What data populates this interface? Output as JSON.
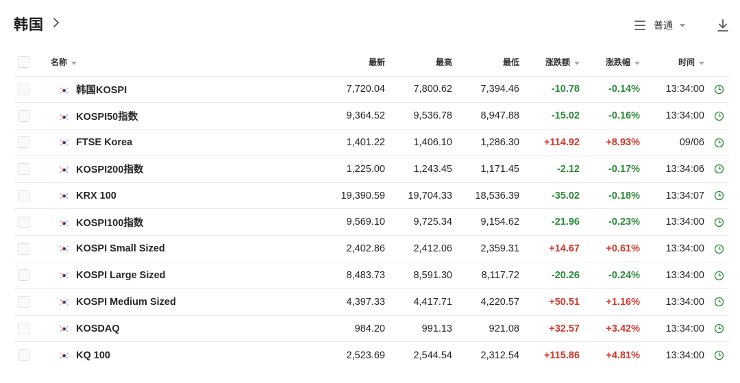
{
  "header": {
    "title": "韩国",
    "view_mode": "普通"
  },
  "table": {
    "columns": {
      "name": "名称",
      "latest": "最新",
      "high": "最高",
      "low": "最低",
      "change": "涨跌额",
      "change_pct": "涨跌幅",
      "time": "时间"
    },
    "rows": [
      {
        "name": "韩国KOSPI",
        "latest": "7,720.04",
        "high": "7,800.62",
        "low": "7,394.46",
        "change": "-10.78",
        "change_pct": "-0.14%",
        "time": "13:34:00",
        "dir": "down"
      },
      {
        "name": "KOSPI50指数",
        "latest": "9,364.52",
        "high": "9,536.78",
        "low": "8,947.88",
        "change": "-15.02",
        "change_pct": "-0.16%",
        "time": "13:34:00",
        "dir": "down"
      },
      {
        "name": "FTSE Korea",
        "latest": "1,401.22",
        "high": "1,406.10",
        "low": "1,286.30",
        "change": "+114.92",
        "change_pct": "+8.93%",
        "time": "09/06",
        "dir": "up"
      },
      {
        "name": "KOSPI200指数",
        "latest": "1,225.00",
        "high": "1,243.45",
        "low": "1,171.45",
        "change": "-2.12",
        "change_pct": "-0.17%",
        "time": "13:34:06",
        "dir": "down"
      },
      {
        "name": "KRX 100",
        "latest": "19,390.59",
        "high": "19,704.33",
        "low": "18,536.39",
        "change": "-35.02",
        "change_pct": "-0.18%",
        "time": "13:34:07",
        "dir": "down"
      },
      {
        "name": "KOSPI100指数",
        "latest": "9,569.10",
        "high": "9,725.34",
        "low": "9,154.62",
        "change": "-21.96",
        "change_pct": "-0.23%",
        "time": "13:34:00",
        "dir": "down"
      },
      {
        "name": "KOSPI Small Sized",
        "latest": "2,402.86",
        "high": "2,412.06",
        "low": "2,359.31",
        "change": "+14.67",
        "change_pct": "+0.61%",
        "time": "13:34:00",
        "dir": "up"
      },
      {
        "name": "KOSPI Large Sized",
        "latest": "8,483.73",
        "high": "8,591.30",
        "low": "8,117.72",
        "change": "-20.26",
        "change_pct": "-0.24%",
        "time": "13:34:00",
        "dir": "down"
      },
      {
        "name": "KOSPI Medium Sized",
        "latest": "4,397.33",
        "high": "4,417.71",
        "low": "4,220.57",
        "change": "+50.51",
        "change_pct": "+1.16%",
        "time": "13:34:00",
        "dir": "up"
      },
      {
        "name": "KOSDAQ",
        "latest": "984.20",
        "high": "991.13",
        "low": "921.08",
        "change": "+32.57",
        "change_pct": "+3.42%",
        "time": "13:34:00",
        "dir": "up"
      },
      {
        "name": "KQ 100",
        "latest": "2,523.69",
        "high": "2,544.54",
        "low": "2,312.54",
        "change": "+115.86",
        "change_pct": "+4.81%",
        "time": "13:34:00",
        "dir": "up"
      }
    ]
  },
  "icons": {
    "row_flag": "south-korea-flag-icon",
    "row_action": "clock-icon",
    "view": "list-menu-icon",
    "download": "download-icon"
  },
  "colors": {
    "up": "#d2372c",
    "down": "#2a8a3a",
    "clock": "#2a8a3a"
  }
}
